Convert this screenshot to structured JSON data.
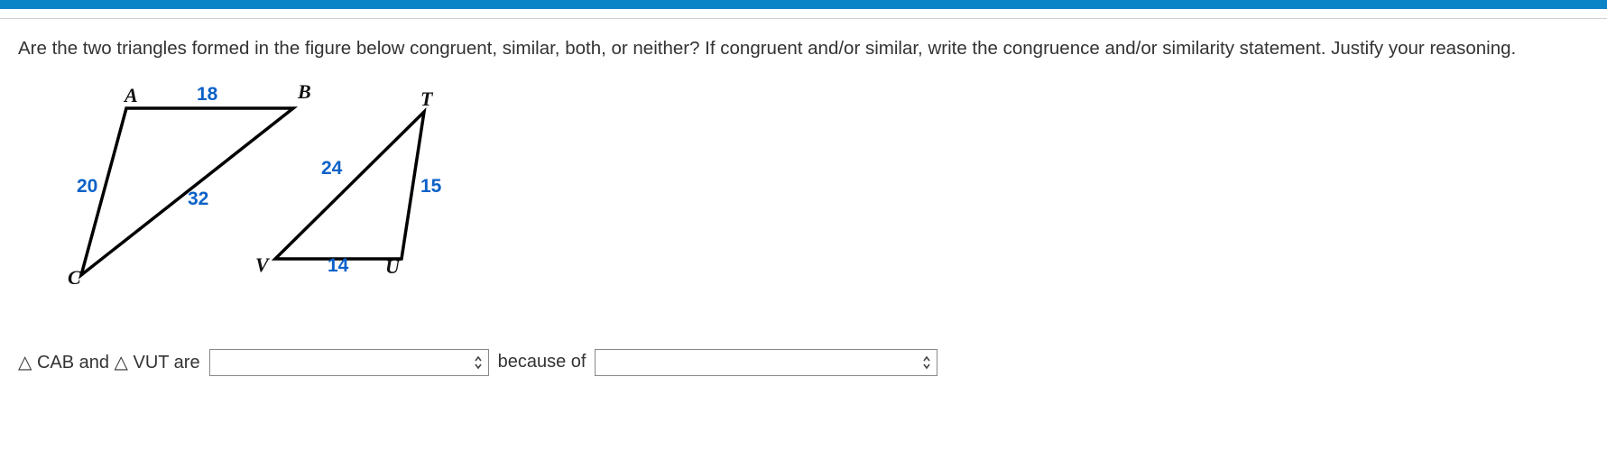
{
  "question": "Are the two triangles formed in the figure below congruent, similar, both, or neither? If congruent and/or similar, write the congruence and/or similarity statement. Justify your reasoning.",
  "figure": {
    "triangle1": {
      "vertices": {
        "A": "A",
        "B": "B",
        "C": "C"
      },
      "edges": {
        "AB": "18",
        "CA": "20",
        "BC": "32"
      }
    },
    "triangle2": {
      "vertices": {
        "T": "T",
        "U": "U",
        "V": "V"
      },
      "edges": {
        "VT": "24",
        "TU": "15",
        "VU": "14"
      }
    }
  },
  "answer": {
    "prefix_tri1": "△ CAB and △ VUT are",
    "select1_value": "",
    "connector": "because of",
    "select2_value": ""
  }
}
